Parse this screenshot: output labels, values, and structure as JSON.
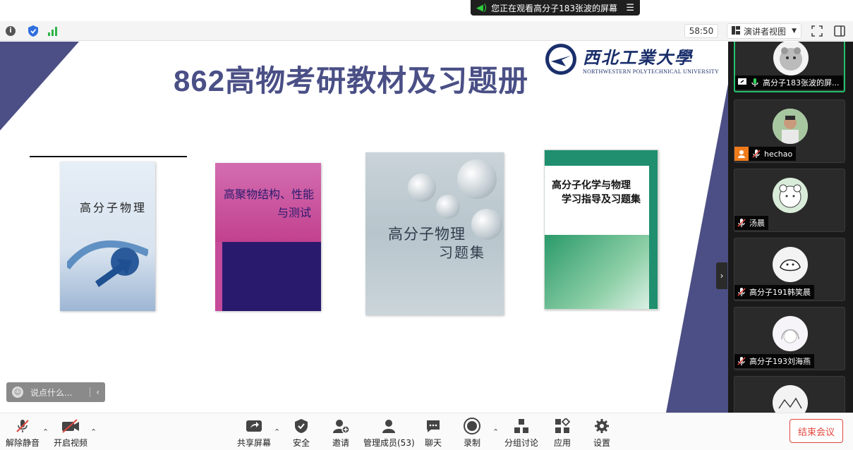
{
  "share_banner": {
    "text": "您正在观看高分子183张波的屏幕",
    "menu_icon": "menu-icon"
  },
  "top_bar": {
    "timer": "58:50",
    "view_label": "演讲者视图"
  },
  "slide": {
    "title": "862高物考研教材及习题册",
    "university_cn": "西北工業大學",
    "university_en": "NORTHWESTERN POLYTECHNICAL UNIVERSITY",
    "book1_title": "高分子物理",
    "book2_title_line1": "高聚物结构、性能",
    "book2_title_line2": "与测试",
    "book3_title_line1": "高分子物理",
    "book3_title_line2": "习题集",
    "book4_title_line1": "高分子化学与物理",
    "book4_title_line2": "学习指导及习题集"
  },
  "chat": {
    "placeholder": "说点什么..."
  },
  "participants": [
    {
      "name": "高分子183张波的屏..."
    },
    {
      "name": "hechao"
    },
    {
      "name": "汤晨"
    },
    {
      "name": "高分子191韩笑晨"
    },
    {
      "name": "高分子193刘海燕"
    },
    {
      "name": ""
    }
  ],
  "toolbar": {
    "unmute": "解除静音",
    "start_video": "开启视频",
    "share_screen": "共享屏幕",
    "security": "安全",
    "invite": "邀请",
    "manage_members": "管理成员(53)",
    "chat": "聊天",
    "record": "录制",
    "breakout": "分组讨论",
    "apps": "应用",
    "settings": "设置",
    "end_meeting": "结束会议"
  },
  "colors": {
    "accent": "#4c4f85",
    "active_green": "#23c16b",
    "end_red": "#e0463e"
  }
}
